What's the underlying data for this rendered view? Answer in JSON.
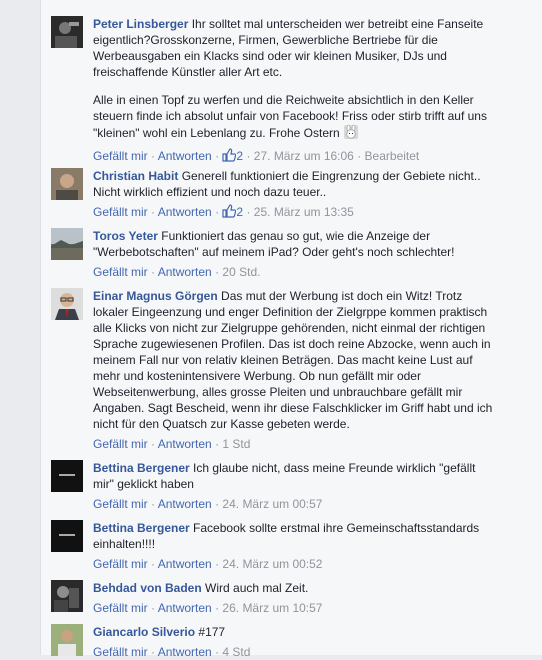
{
  "comments": [
    {
      "author": "Peter Linsberger",
      "text": "Ihr solltet mal unterscheiden wer betreibt eine Fanseite eigentlich?Grosskonzerne, Firmen, Gewerbliche Bertriebe für die Werbeausgaben ein Klacks sind oder wir kleinen Musiker, DJs und freischaffende Künstler aller Art etc.",
      "text2": "Alle in einen Topf zu werfen und die Reichweite absichtlich in den Keller steuern finde ich absolut unfair von Facebook! Friss oder stirb trifft auf uns \"kleinen\" wohl ein Lebenlang zu. Frohe Ostern",
      "like_label": "Gefällt mir",
      "reply_label": "Antworten",
      "likes": "2",
      "time": "27. März um 16:06",
      "edited": "Bearbeitet",
      "avatar_icon": "dj-photo-avatar"
    },
    {
      "author": "Christian Habit",
      "text": "Generell funktioniert die Eingrenzung der Gebiete nicht.. Nicht wirklich effizient und noch dazu teuer..",
      "like_label": "Gefällt mir",
      "reply_label": "Antworten",
      "likes": "2",
      "time": "25. März um 13:35",
      "avatar_icon": "portrait-avatar"
    },
    {
      "author": "Toros Yeter",
      "text": "Funktioniert das genau so gut, wie die Anzeige der \"Werbebotschaften\" auf meinem iPad? Oder geht's noch schlechter!",
      "like_label": "Gefällt mir",
      "reply_label": "Antworten",
      "time": "20 Std.",
      "avatar_icon": "landscape-avatar"
    },
    {
      "author": "Einar Magnus Görgen",
      "text": "Das mut der Werbung ist doch ein Witz! Trotz lokaler Eingeenzung und enger Definition der Zielgrppe kommen praktisch alle Klicks von nicht zur Zielgruppe gehörenden, nicht einmal der richtigen Sprache zugewiesenen Profilen. Das ist doch reine Abzocke, wenn auch in meinem Fall nur von relativ kleinen Beträgen. Das macht keine Lust auf mehr und kostenintensivere Werbung. Ob nun gefällt mir oder Webseitenwerbung, alles grosse Pleiten und unbrauchbare gefällt mir Angaben. Sagt Bescheid, wenn ihr diese Falschklicker im Griff habt und ich nicht für den Quatsch zur Kasse gebeten werde.",
      "like_label": "Gefällt mir",
      "reply_label": "Antworten",
      "time": "1 Std",
      "avatar_icon": "man-with-glasses-avatar"
    },
    {
      "author": "Bettina Bergener",
      "text": "Ich glaube nicht, dass meine Freunde wirklich \"gefällt mir\" geklickt haben",
      "like_label": "Gefällt mir",
      "reply_label": "Antworten",
      "time": "24. März um 00:57",
      "avatar_icon": "black-logo-avatar"
    },
    {
      "author": "Bettina Bergener",
      "text": "Facebook sollte erstmal ihre Gemeinschaftsstandards einhalten!!!!",
      "like_label": "Gefällt mir",
      "reply_label": "Antworten",
      "time": "24. März um 00:52",
      "avatar_icon": "black-logo-avatar"
    },
    {
      "author": "Behdad von Baden",
      "text": "Wird auch mal Zeit.",
      "like_label": "Gefällt mir",
      "reply_label": "Antworten",
      "time": "26. März um 10:57",
      "avatar_icon": "dark-photo-avatar"
    },
    {
      "author": "Giancarlo Silverio",
      "text": "#177",
      "like_label": "Gefällt mir",
      "reply_label": "Antworten",
      "time": "4 Std",
      "avatar_icon": "person-outdoor-avatar"
    }
  ],
  "separator": "·",
  "colors": {
    "link": "#4267b2",
    "author": "#365899",
    "meta": "#90949c",
    "bg": "#f6f7f9"
  }
}
